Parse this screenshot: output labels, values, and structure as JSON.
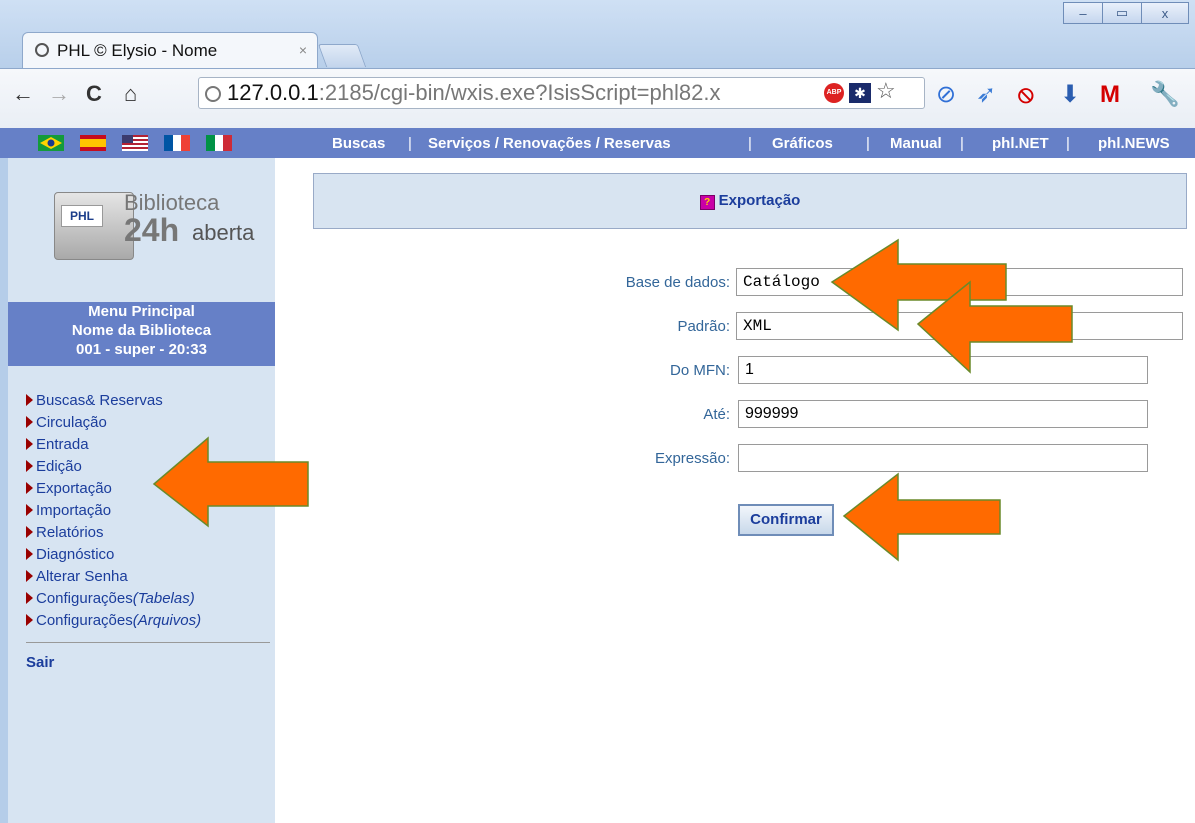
{
  "browser": {
    "tab_title": "PHL © Elysio - Nome",
    "tab_close": "×",
    "url_host": "127.0.0.1",
    "url_rest": ":2185/cgi-bin/wxis.exe?IsisScript=phl82.x",
    "abp_label": "ABP",
    "window_controls": [
      "–",
      "▭",
      "x"
    ],
    "nav_icons": [
      "←",
      "→",
      "C",
      "⌂"
    ]
  },
  "topnav": {
    "links": [
      "Buscas",
      "Serviços / Renovações / Reservas",
      "Gráficos",
      "Manual",
      "phl.NET",
      "phl.NEWS"
    ],
    "separator": "|",
    "flags": [
      "brazil-flag",
      "spain-flag",
      "usa-flag",
      "france-flag",
      "italy-flag"
    ]
  },
  "logo": {
    "phl": "PHL",
    "biblioteca": "Biblioteca",
    "h24": "24h",
    "aberta": "aberta"
  },
  "sidebar": {
    "menu_title": "Menu Principal",
    "library_name": "Nome da Biblioteca",
    "session": "001 - super - 20:33",
    "items": [
      {
        "label": "Buscas& Reservas",
        "suffix": ""
      },
      {
        "label": "Circulação",
        "suffix": ""
      },
      {
        "label": "Entrada",
        "suffix": ""
      },
      {
        "label": "Edição",
        "suffix": ""
      },
      {
        "label": "Exportação",
        "suffix": ""
      },
      {
        "label": "Importação",
        "suffix": ""
      },
      {
        "label": "Relatórios",
        "suffix": ""
      },
      {
        "label": "Diagnóstico",
        "suffix": ""
      },
      {
        "label": "Alterar Senha",
        "suffix": ""
      },
      {
        "label": "Configurações",
        "suffix": "(Tabelas)"
      },
      {
        "label": "Configurações",
        "suffix": "(Arquivos)"
      }
    ],
    "logout": "Sair"
  },
  "main": {
    "title": "Exportação",
    "help_glyph": "?",
    "fields": {
      "database_label": "Base de dados:",
      "database_value": "Catálogo",
      "standard_label": "Padrão:",
      "standard_value": "XML",
      "from_mfn_label": "Do MFN:",
      "from_mfn_value": "1",
      "to_label": "Até:",
      "to_value": "999999",
      "expression_label": "Expressão:",
      "expression_value": ""
    },
    "confirm_label": "Confirmar"
  },
  "colors": {
    "nav_blue": "#6680c7",
    "sidebar_bg": "#d7e4f2",
    "link_blue": "#1b3d9c",
    "arrow_orange": "#ff6a00"
  }
}
